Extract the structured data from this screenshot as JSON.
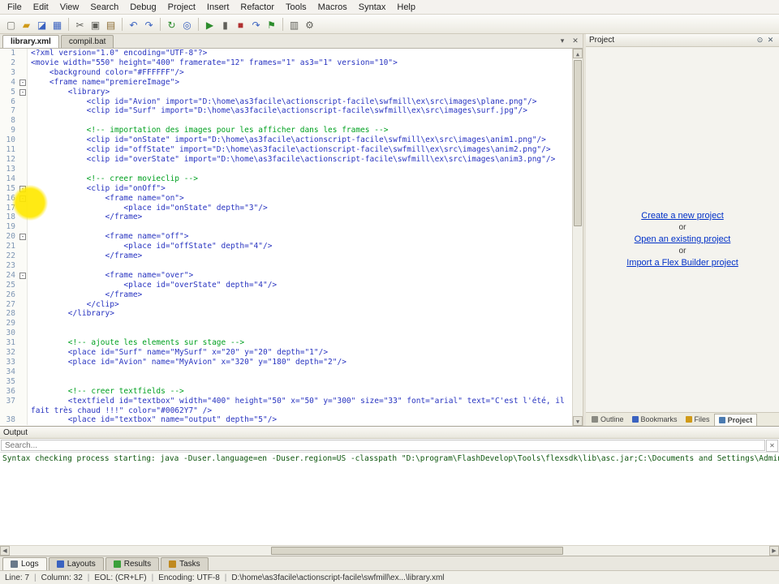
{
  "menu": {
    "items": [
      "File",
      "Edit",
      "View",
      "Search",
      "Debug",
      "Project",
      "Insert",
      "Refactor",
      "Tools",
      "Macros",
      "Syntax",
      "Help"
    ]
  },
  "toolbar": {
    "groups": [
      [
        {
          "name": "new-document-icon",
          "glyph": "▢",
          "color": "#7a7a72"
        },
        {
          "name": "open-folder-icon",
          "glyph": "▰",
          "color": "#d09a18"
        },
        {
          "name": "save-icon",
          "glyph": "◪",
          "color": "#3a62c0"
        },
        {
          "name": "save-all-icon",
          "glyph": "▦",
          "color": "#3a62c0"
        }
      ],
      [
        {
          "name": "cut-icon",
          "glyph": "✂",
          "color": "#60605a"
        },
        {
          "name": "copy-icon",
          "glyph": "▣",
          "color": "#60605a"
        },
        {
          "name": "paste-icon",
          "glyph": "▤",
          "color": "#8a6a30"
        }
      ],
      [
        {
          "name": "undo-icon",
          "glyph": "↶",
          "color": "#3a62c0"
        },
        {
          "name": "redo-icon",
          "glyph": "↷",
          "color": "#3a62c0"
        }
      ],
      [
        {
          "name": "refresh-icon",
          "glyph": "↻",
          "color": "#2c8c2c"
        },
        {
          "name": "search-icon",
          "glyph": "◎",
          "color": "#3a62c0"
        }
      ],
      [
        {
          "name": "run-icon",
          "glyph": "▶",
          "color": "#2c8c2c"
        },
        {
          "name": "pause-icon",
          "glyph": "▮",
          "color": "#60605a"
        },
        {
          "name": "stop-icon",
          "glyph": "■",
          "color": "#b03030"
        },
        {
          "name": "step-over-icon",
          "glyph": "↷",
          "color": "#3a62c0"
        },
        {
          "name": "debug-flag-icon",
          "glyph": "⚑",
          "color": "#2c8c2c"
        }
      ],
      [
        {
          "name": "panels-icon",
          "glyph": "▥",
          "color": "#60605a"
        },
        {
          "name": "settings-gear-icon",
          "glyph": "⚙",
          "color": "#60605a"
        }
      ]
    ]
  },
  "editor_tabs": [
    {
      "label": "library.xml",
      "active": true
    },
    {
      "label": "compil.bat",
      "active": false
    }
  ],
  "icons": {
    "tab_list": "▾",
    "close": "✕",
    "pin": "⊙",
    "scroll_up": "▲",
    "scroll_down": "▼",
    "scroll_left": "◀",
    "scroll_right": "▶",
    "search_clear": "✕"
  },
  "code": {
    "fold_glyph": "-",
    "lines": [
      {
        "n": 1,
        "t": "<?xml version=\"1.0\" encoding=\"UTF-8\"?>"
      },
      {
        "n": 2,
        "t": "<movie width=\"550\" height=\"400\" framerate=\"12\" frames=\"1\" as3=\"1\" version=\"10\">"
      },
      {
        "n": 3,
        "t": "    <background color=\"#FFFFFF\"/>"
      },
      {
        "n": 4,
        "f": 1,
        "t": "    <frame name=\"premiereImage\">"
      },
      {
        "n": 5,
        "f": 1,
        "t": "        <library>"
      },
      {
        "n": 6,
        "t": "            <clip id=\"Avion\" import=\"D:\\home\\as3facile\\actionscript-facile\\swfmill\\ex\\src\\images\\plane.png\"/>"
      },
      {
        "n": 7,
        "t": "            <clip id=\"Surf\" import=\"D:\\home\\as3facile\\actionscript-facile\\swfmill\\ex\\src\\images\\surf.jpg\"/>"
      },
      {
        "n": 8,
        "t": ""
      },
      {
        "n": 9,
        "c": 1,
        "t": "            <!-- importation des images pour les afficher dans les frames -->"
      },
      {
        "n": 10,
        "t": "            <clip id=\"onState\" import=\"D:\\home\\as3facile\\actionscript-facile\\swfmill\\ex\\src\\images\\anim1.png\"/>"
      },
      {
        "n": 11,
        "t": "            <clip id=\"offState\" import=\"D:\\home\\as3facile\\actionscript-facile\\swfmill\\ex\\src\\images\\anim2.png\"/>"
      },
      {
        "n": 12,
        "t": "            <clip id=\"overState\" import=\"D:\\home\\as3facile\\actionscript-facile\\swfmill\\ex\\src\\images\\anim3.png\"/>"
      },
      {
        "n": 13,
        "t": ""
      },
      {
        "n": 14,
        "c": 1,
        "t": "            <!-- creer movieclip -->"
      },
      {
        "n": 15,
        "f": 1,
        "t": "            <clip id=\"onOff\">"
      },
      {
        "n": 16,
        "f": 1,
        "t": "                <frame name=\"on\">"
      },
      {
        "n": 17,
        "t": "                    <place id=\"onState\" depth=\"3\"/>"
      },
      {
        "n": 18,
        "t": "                </frame>"
      },
      {
        "n": 19,
        "t": ""
      },
      {
        "n": 20,
        "f": 1,
        "t": "                <frame name=\"off\">"
      },
      {
        "n": 21,
        "t": "                    <place id=\"offState\" depth=\"4\"/>"
      },
      {
        "n": 22,
        "t": "                </frame>"
      },
      {
        "n": 23,
        "t": ""
      },
      {
        "n": 24,
        "f": 1,
        "t": "                <frame name=\"over\">"
      },
      {
        "n": 25,
        "t": "                    <place id=\"overState\" depth=\"4\"/>"
      },
      {
        "n": 26,
        "t": "                </frame>"
      },
      {
        "n": 27,
        "t": "            </clip>"
      },
      {
        "n": 28,
        "t": "        </library>"
      },
      {
        "n": 29,
        "t": ""
      },
      {
        "n": 30,
        "t": ""
      },
      {
        "n": 31,
        "c": 1,
        "t": "        <!-- ajoute les elements sur stage -->"
      },
      {
        "n": 32,
        "t": "        <place id=\"Surf\" name=\"MySurf\" x=\"20\" y=\"20\" depth=\"1\"/>"
      },
      {
        "n": 33,
        "t": "        <place id=\"Avion\" name=\"MyAvion\" x=\"320\" y=\"180\" depth=\"2\"/>"
      },
      {
        "n": 34,
        "t": ""
      },
      {
        "n": 35,
        "t": ""
      },
      {
        "n": 36,
        "c": 1,
        "t": "        <!-- creer textfields -->"
      },
      {
        "n": 37,
        "t": "        <textfield id=\"textbox\" width=\"400\" height=\"50\" x=\"50\" y=\"300\" size=\"33\" font=\"arial\" text=\"C'est l'été, il fait très chaud !!!\" color=\"#0062Y7\" />"
      },
      {
        "n": 38,
        "t": "        <place id=\"textbox\" name=\"output\" depth=\"5\"/>"
      }
    ]
  },
  "project_panel": {
    "title": "Project",
    "items": [
      {
        "label": "Create a new project",
        "link": true
      },
      {
        "label": "or",
        "link": false
      },
      {
        "label": "Open an existing project",
        "link": true
      },
      {
        "label": "or",
        "link": false
      },
      {
        "label": "Import a Flex Builder project",
        "link": true
      }
    ]
  },
  "panel_tabs": [
    {
      "label": "Outline",
      "icon_color": "#8a8a82",
      "active": false
    },
    {
      "label": "Bookmarks",
      "icon_color": "#3a62c0",
      "active": false
    },
    {
      "label": "Files",
      "icon_color": "#d09a18",
      "active": false
    },
    {
      "label": "Project",
      "icon_color": "#4a7ab0",
      "active": true
    }
  ],
  "output": {
    "title": "Output",
    "search_placeholder": "Search...",
    "text": "Syntax checking process starting: java -Duser.language=en -Duser.region=US -classpath \"D:\\program\\FlashDevelop\\Tools\\flexsdk\\lib\\asc.jar;C:\\Documents and Settings\\Administrateur\\loca"
  },
  "dock_tabs": [
    {
      "label": "Logs",
      "icon_color": "#6a7a8a",
      "active": true
    },
    {
      "label": "Layouts",
      "icon_color": "#3a62c0",
      "active": false
    },
    {
      "label": "Results",
      "icon_color": "#3aa03a",
      "active": false
    },
    {
      "label": "Tasks",
      "icon_color": "#c08a20",
      "active": false
    }
  ],
  "status": {
    "segments": [
      {
        "name": "line",
        "text": "Line: 7"
      },
      {
        "name": "column",
        "text": "Column: 32"
      },
      {
        "name": "eol",
        "text": "EOL: (CR+LF)"
      },
      {
        "name": "encoding",
        "text": "Encoding: UTF-8"
      },
      {
        "name": "file-path",
        "text": "D:\\home\\as3facile\\actionscript-facile\\swfmill\\ex...\\library.xml"
      }
    ]
  },
  "colors": {
    "code": "#2733c0",
    "comment": "#00a020",
    "link": "#0030c8",
    "line_number": "#7e96b4",
    "output_text": "#0e560e",
    "highlight": "#ffe800"
  }
}
